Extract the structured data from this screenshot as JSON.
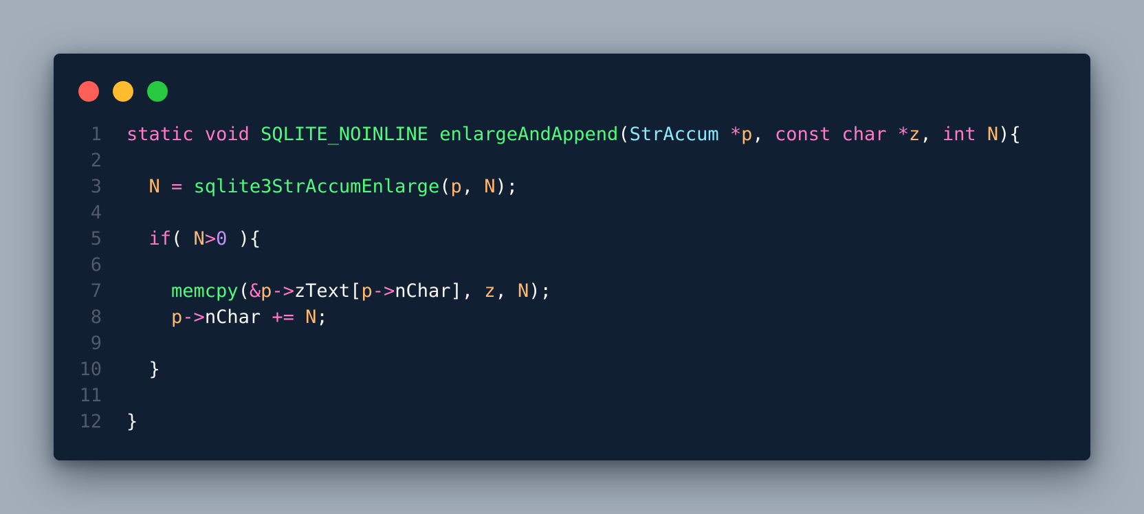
{
  "window": {
    "controls": {
      "close": "close",
      "minimize": "minimize",
      "maximize": "maximize"
    },
    "colors": {
      "background": "#111f33",
      "close": "#ff5f57",
      "minimize": "#febc2e",
      "maximize": "#28c840"
    }
  },
  "code": {
    "lines": [
      {
        "number": "1",
        "tokens": [
          {
            "text": "static",
            "kind": "keyword"
          },
          {
            "text": " ",
            "kind": "plain"
          },
          {
            "text": "void",
            "kind": "keyword"
          },
          {
            "text": " ",
            "kind": "plain"
          },
          {
            "text": "SQLITE_NOINLINE",
            "kind": "function"
          },
          {
            "text": " ",
            "kind": "plain"
          },
          {
            "text": "enlargeAndAppend",
            "kind": "function"
          },
          {
            "text": "(",
            "kind": "plain"
          },
          {
            "text": "StrAccum",
            "kind": "type"
          },
          {
            "text": " ",
            "kind": "plain"
          },
          {
            "text": "*",
            "kind": "keyword"
          },
          {
            "text": "p",
            "kind": "variable"
          },
          {
            "text": ", ",
            "kind": "plain"
          },
          {
            "text": "const",
            "kind": "keyword"
          },
          {
            "text": " ",
            "kind": "plain"
          },
          {
            "text": "char",
            "kind": "keyword"
          },
          {
            "text": " ",
            "kind": "plain"
          },
          {
            "text": "*",
            "kind": "keyword"
          },
          {
            "text": "z",
            "kind": "variable"
          },
          {
            "text": ", ",
            "kind": "plain"
          },
          {
            "text": "int",
            "kind": "keyword"
          },
          {
            "text": " ",
            "kind": "plain"
          },
          {
            "text": "N",
            "kind": "variable"
          },
          {
            "text": "){",
            "kind": "plain"
          }
        ]
      },
      {
        "number": "2",
        "tokens": []
      },
      {
        "number": "3",
        "tokens": [
          {
            "text": "  ",
            "kind": "plain"
          },
          {
            "text": "N",
            "kind": "variable"
          },
          {
            "text": " ",
            "kind": "plain"
          },
          {
            "text": "=",
            "kind": "keyword"
          },
          {
            "text": " ",
            "kind": "plain"
          },
          {
            "text": "sqlite3StrAccumEnlarge",
            "kind": "function"
          },
          {
            "text": "(",
            "kind": "plain"
          },
          {
            "text": "p",
            "kind": "variable"
          },
          {
            "text": ", ",
            "kind": "plain"
          },
          {
            "text": "N",
            "kind": "variable"
          },
          {
            "text": ");",
            "kind": "plain"
          }
        ]
      },
      {
        "number": "4",
        "tokens": []
      },
      {
        "number": "5",
        "tokens": [
          {
            "text": "  ",
            "kind": "plain"
          },
          {
            "text": "if",
            "kind": "keyword"
          },
          {
            "text": "( ",
            "kind": "plain"
          },
          {
            "text": "N",
            "kind": "variable"
          },
          {
            "text": ">",
            "kind": "keyword"
          },
          {
            "text": "0",
            "kind": "number"
          },
          {
            "text": " ){",
            "kind": "plain"
          }
        ]
      },
      {
        "number": "6",
        "tokens": []
      },
      {
        "number": "7",
        "tokens": [
          {
            "text": "    ",
            "kind": "plain"
          },
          {
            "text": "memcpy",
            "kind": "function"
          },
          {
            "text": "(",
            "kind": "plain"
          },
          {
            "text": "&",
            "kind": "keyword"
          },
          {
            "text": "p",
            "kind": "variable"
          },
          {
            "text": "->",
            "kind": "keyword"
          },
          {
            "text": "zText[",
            "kind": "plain"
          },
          {
            "text": "p",
            "kind": "variable"
          },
          {
            "text": "->",
            "kind": "keyword"
          },
          {
            "text": "nChar], ",
            "kind": "plain"
          },
          {
            "text": "z",
            "kind": "variable"
          },
          {
            "text": ", ",
            "kind": "plain"
          },
          {
            "text": "N",
            "kind": "variable"
          },
          {
            "text": ");",
            "kind": "plain"
          }
        ]
      },
      {
        "number": "8",
        "tokens": [
          {
            "text": "    ",
            "kind": "plain"
          },
          {
            "text": "p",
            "kind": "variable"
          },
          {
            "text": "->",
            "kind": "keyword"
          },
          {
            "text": "nChar ",
            "kind": "plain"
          },
          {
            "text": "+=",
            "kind": "keyword"
          },
          {
            "text": " ",
            "kind": "plain"
          },
          {
            "text": "N",
            "kind": "variable"
          },
          {
            "text": ";",
            "kind": "plain"
          }
        ]
      },
      {
        "number": "9",
        "tokens": []
      },
      {
        "number": "10",
        "tokens": [
          {
            "text": "  ",
            "kind": "plain"
          },
          {
            "text": "}",
            "kind": "plain"
          }
        ]
      },
      {
        "number": "11",
        "tokens": []
      },
      {
        "number": "12",
        "tokens": [
          {
            "text": "}",
            "kind": "plain"
          }
        ]
      }
    ]
  }
}
